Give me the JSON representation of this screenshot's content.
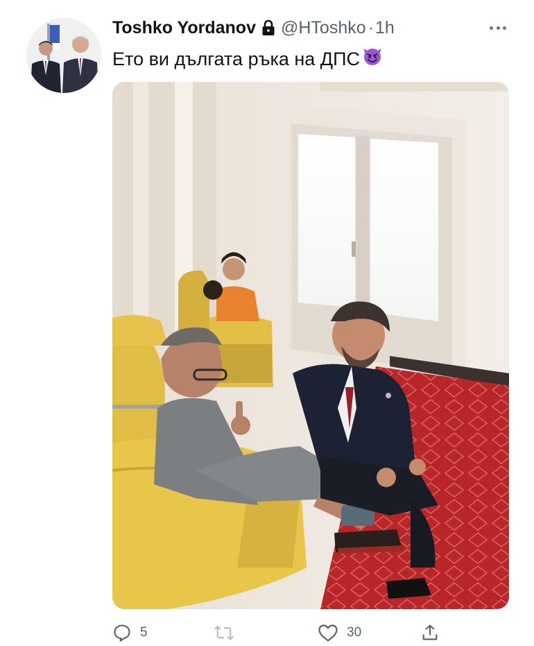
{
  "tweet": {
    "display_name": "Toshko Yordanov",
    "handle": "@HToshko",
    "separator": "·",
    "time": "1h",
    "text": "Ето ви дългата ръка на ДПС",
    "emoji": "smiling-face-with-horns-icon",
    "protected": true
  },
  "actions": {
    "reply_count": "5",
    "retweet_count": "",
    "like_count": "30"
  },
  "colors": {
    "text": "#0f1419",
    "secondary": "#56626e",
    "emoji_purple": "#9b59d0",
    "carpet_red": "#b8262a",
    "armchair_yellow": "#e8c64a"
  }
}
